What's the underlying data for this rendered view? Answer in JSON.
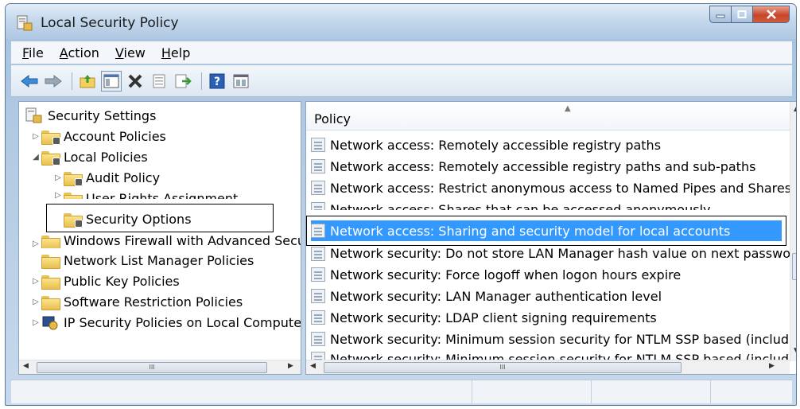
{
  "window": {
    "title": "Local Security Policy"
  },
  "menu": [
    {
      "label": "File",
      "u": "F",
      "rest": "ile"
    },
    {
      "label": "Action",
      "u": "A",
      "rest": "ction"
    },
    {
      "label": "View",
      "u": "V",
      "rest": "iew"
    },
    {
      "label": "Help",
      "u": "H",
      "rest": "elp"
    }
  ],
  "toolbar": {
    "buttons": [
      "back-arrow-icon",
      "forward-arrow-icon",
      "up-folder-icon",
      "show-hide-tree-icon",
      "delete-icon",
      "properties-icon",
      "export-list-icon",
      "help-icon",
      "view-icon"
    ]
  },
  "tree": {
    "root": "Security Settings",
    "items": [
      {
        "label": "Account Policies"
      },
      {
        "label": "Local Policies"
      },
      {
        "label": "Audit Policy"
      },
      {
        "label": "User Rights Assignment"
      },
      {
        "label": "Security Options"
      },
      {
        "label": "Windows Firewall with Advanced Secu"
      },
      {
        "label": "Network List Manager Policies"
      },
      {
        "label": "Public Key Policies"
      },
      {
        "label": "Software Restriction Policies"
      },
      {
        "label": "IP Security Policies on Local Compute"
      }
    ],
    "hscroll_glyph": "III"
  },
  "list": {
    "header": "Policy",
    "rows": [
      "Network access: Remotely accessible registry paths",
      "Network access: Remotely accessible registry paths and sub-paths",
      "Network access: Restrict anonymous access to Named Pipes and Shares",
      "Network access: Shares that can be accessed anonymously",
      "Network access: Sharing and security model for local accounts",
      "Network security: Do not store LAN Manager hash value on next password",
      "Network security: Force logoff when logon hours expire",
      "Network security: LAN Manager authentication level",
      "Network security: LDAP client signing requirements",
      "Network security: Minimum session security for NTLM SSP based (includir",
      "Network security: Minimum session security for NTLM SSP based (includi"
    ],
    "selected_index": 4,
    "hscroll_glyph": "III"
  }
}
